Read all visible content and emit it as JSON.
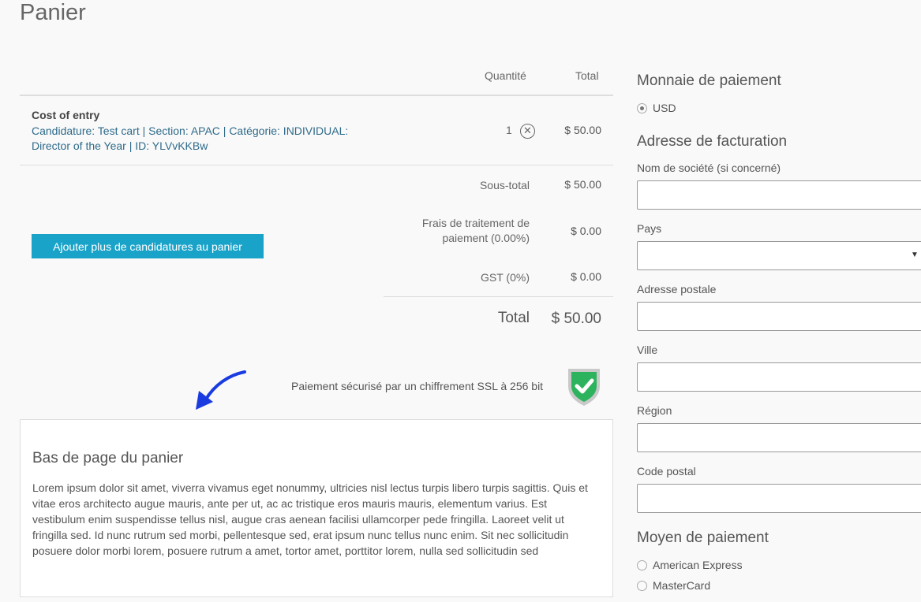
{
  "page": {
    "title": "Panier"
  },
  "cart": {
    "headers": {
      "quantity": "Quantité",
      "total": "Total"
    },
    "item": {
      "name": "Cost of entry",
      "description": "Candidature: Test cart | Section: APAC | Catégorie: INDIVIDUAL: Director of the Year | ID: YLVvKKBw",
      "quantity": "1",
      "total": "$ 50.00"
    },
    "remove_glyph": "✕",
    "subtotal_label": "Sous-total",
    "subtotal_value": "$ 50.00",
    "fees_label": "Frais de traitement de paiement (0.00%)",
    "fees_value": "$ 0.00",
    "gst_label": "GST (0%)",
    "gst_value": "$ 0.00",
    "total_label": "Total",
    "total_value": "$ 50.00",
    "add_button_label": "Ajouter plus de candidatures au panier"
  },
  "security": {
    "ssl_text": "Paiement sécurisé par un chiffrement SSL à 256 bit"
  },
  "footer": {
    "title": "Bas de page du panier",
    "text": "Lorem ipsum dolor sit amet, viverra vivamus eget nonummy, ultricies nisl lectus turpis libero turpis sagittis. Quis et vitae eros architecto augue mauris, ante per ut, ac ac tristique eros mauris mauris, elementum varius. Est vestibulum enim suspendisse tellus nisl, augue cras aenean facilisi ullamcorper pede fringilla. Laoreet velit ut fringilla sed. Id nunc rutrum sed morbi, pellentesque sed, erat ipsum nunc tellus nunc enim. Sit nec sollicitudin posuere dolor morbi lorem, posuere rutrum a amet, tortor amet, porttitor lorem, nulla sed sollicitudin sed"
  },
  "payment_currency": {
    "title": "Monnaie de paiement",
    "option": "USD"
  },
  "billing": {
    "title": "Adresse de facturation",
    "company_label": "Nom de société (si concerné)",
    "country_label": "Pays",
    "street_label": "Adresse postale",
    "city_label": "Ville",
    "region_label": "Région",
    "postal_label": "Code postal",
    "select_arrow": "▼"
  },
  "payment_method": {
    "title": "Moyen de paiement",
    "options": [
      "American Express",
      "MasterCard"
    ]
  },
  "colors": {
    "accent_button": "#1aa3c9",
    "link_text": "#2e6b8a",
    "shield_green": "#2db35d",
    "arrow_blue": "#1a3be0"
  }
}
